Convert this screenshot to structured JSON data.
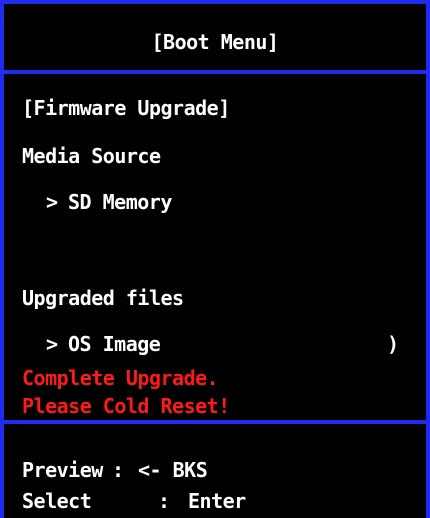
{
  "header": {
    "title": "[Boot Menu]"
  },
  "section": {
    "title": "[Firmware Upgrade]"
  },
  "media_source": {
    "label": "Media Source",
    "marker": ">",
    "value": "SD Memory"
  },
  "upgraded_files": {
    "label": "Upgraded files",
    "marker": ">",
    "value": "OS Image",
    "trailing": ")"
  },
  "status": {
    "line1": "Complete Upgrade.",
    "line2": "Please Cold Reset!"
  },
  "footer": {
    "preview_label": "Preview",
    "preview_sep": ":",
    "preview_key": "<- BKS",
    "select_label": "Select",
    "select_sep": ":",
    "select_key": "Enter"
  },
  "colors": {
    "border": "#1f2cf0",
    "background": "#000000",
    "text": "#ffffff",
    "alert": "#ff1a1a"
  }
}
